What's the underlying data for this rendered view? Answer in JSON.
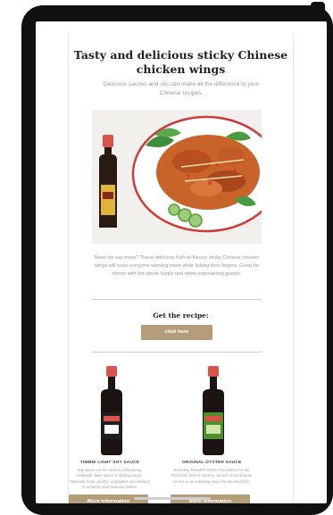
{
  "email": {
    "title": "Tasty and delicious sticky Chinese chicken wings",
    "subtitle": "Delicious sauces and oils can make all the difference to your Chinese recipes.",
    "body_text": "Need we say more? These delicious Koh-of-flavour sticky Chinese chicken wings will have everyone wanting more while licking their fingers. Great for dinner with the whole family and when entertaining guests.",
    "recipe_prompt": "Get the recipe:",
    "recipe_button_label": "click here"
  },
  "products": [
    {
      "name": "TIMMIE LIGHT SOY SAUCE",
      "description": "Soy sauce can be used as a flavouring, marinade, table sauce or dipping sauce. Marinade meat, poultry, vegetables and seafood to enhance your favourite dishes.",
      "button_label": "More information",
      "cap_color": "#d9534a",
      "label_color": "#1f1f1f"
    },
    {
      "name": "ORIGINAL OYSTER SAUCE",
      "description": "Everyday Stewart's Oyster fine perfect for stir fried beef, pork or chicken, as well as snow peas on rice or as a dipping sauce for steamed fish.",
      "button_label": "More information",
      "cap_color": "#d9534a",
      "label_color": "#4f8f2a"
    }
  ],
  "colors": {
    "button": "#b39d7b",
    "device": "#111111"
  }
}
